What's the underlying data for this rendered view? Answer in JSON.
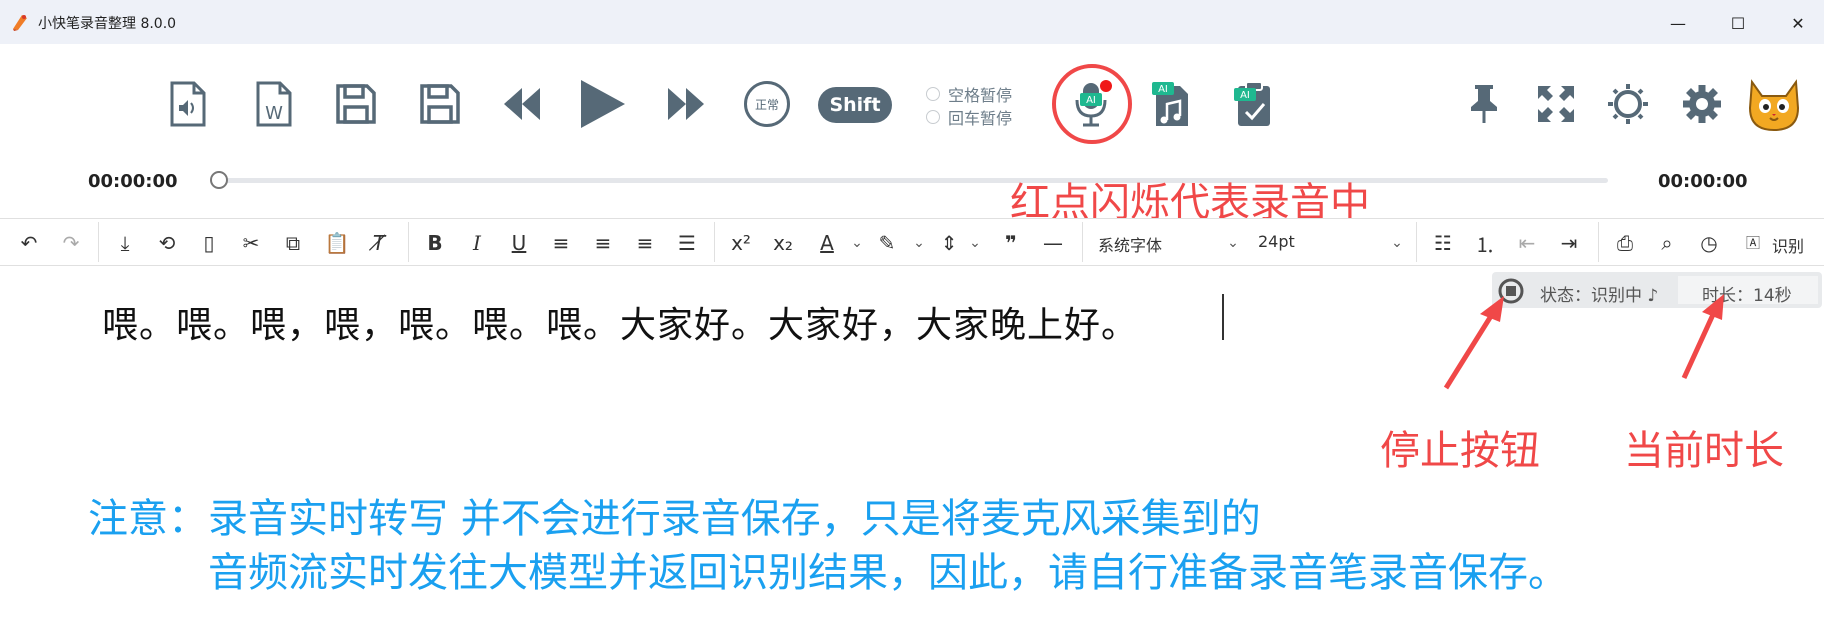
{
  "window": {
    "title": "小快笔录音整理 8.0.0",
    "minimize": "—",
    "maximize": "☐",
    "close": "✕"
  },
  "toolbar": {
    "normal_label": "正常",
    "shift_label": "Shift",
    "space_pause": "空格暂停",
    "enter_pause": "回车暂停",
    "ai_badge": "AI"
  },
  "player": {
    "current_time": "00:00:00",
    "total_time": "00:00:00",
    "progress": 0
  },
  "annotations": {
    "recording_note": "红点闪烁代表录音中",
    "stop_button": "停止按钮",
    "current_duration": "当前时长",
    "notice_line1": "注意：录音实时转写  并不会进行录音保存，只是将麦克风采集到的",
    "notice_line2": "音频流实时发往大模型并返回识别结果，因此，请自行准备录音笔录音保存。"
  },
  "editor": {
    "font_family": "系统字体",
    "font_size": "24pt",
    "recognize_label": "识别",
    "text": "喂。喂。喂，喂，喂。喂。喂。大家好。大家好，大家晚上好。"
  },
  "status": {
    "state": "状态：识别中 ♪",
    "duration": "时长：14秒"
  },
  "colors": {
    "accent_red": "#f04848",
    "notice_blue": "#1aa0f0",
    "icon_slate": "#566977",
    "ai_green": "#1fb890"
  }
}
